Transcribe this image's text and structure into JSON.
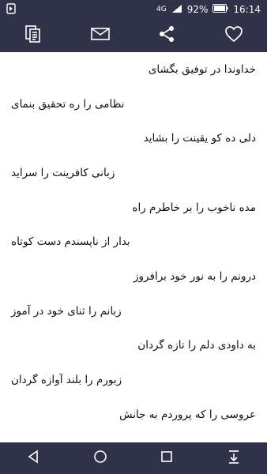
{
  "status": {
    "signal": "4G",
    "battery": "92%",
    "time": "16:14"
  },
  "toolbar": {
    "icons": [
      "pages-icon",
      "mail-icon",
      "share-icon",
      "heart-icon"
    ]
  },
  "verses": [
    "خداوندا در توفیق بگشای",
    "نظامی را ره تحقیق بنمای",
    "دلی ده کو یقینت را بشاید",
    "زبانی کافرینت را سراید",
    "مده ناخوب را بر خاطرم راه",
    "بدار از ناپسندم دست کوتاه",
    "درونم را به نور خود برافروز",
    "زبانم را ثنای خود در آموز",
    "به داودی دلم را تازه گردان",
    "زبورم را بلند آوازه گردان",
    "عروسی را که پروردم به جانش"
  ],
  "colors": {
    "bar": "#2f3248",
    "text": "#111111",
    "background": "#ffffff"
  }
}
